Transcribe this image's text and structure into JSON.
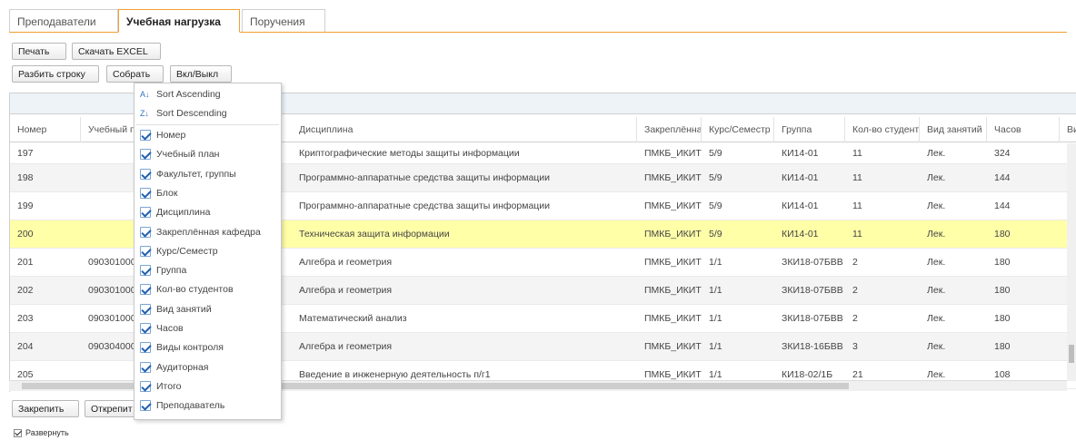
{
  "tabs": [
    {
      "label": "Преподаватели"
    },
    {
      "label": "Учебная нагрузка"
    },
    {
      "label": "Поручения"
    }
  ],
  "toolbar": {
    "print": "Печать",
    "excel": "Скачать EXCEL",
    "split": "Разбить строку",
    "collect": "Собрать",
    "toggle": "Вкл/Выкл",
    "pin": "Закрепить",
    "unpin": "Открепит"
  },
  "columns": {
    "nomer": "Номер",
    "plan": "Учебный п",
    "disc": "Дисциплина",
    "kaf": "Закреплённая",
    "kurs": "Курс/Семестр",
    "group": "Группа",
    "students": "Кол-во студент",
    "vid": "Вид занятий",
    "hours": "Часов",
    "vi": "Ви"
  },
  "rows": [
    {
      "nomer": "197",
      "plan": "",
      "disc": "Криптографические методы защиты информации",
      "kaf": "ПМКБ_ИКИТ",
      "kurs": "5/9",
      "group": "КИ14-01",
      "students": "11",
      "vid": "Лек.",
      "hours": "324",
      "vi": ":"
    },
    {
      "nomer": "198",
      "plan": "",
      "disc": "Программно-аппаратные средства защиты информации",
      "kaf": "ПМКБ_ИКИТ",
      "kurs": "5/9",
      "group": "КИ14-01",
      "students": "11",
      "vid": "Лек.",
      "hours": "144",
      "vi": ":"
    },
    {
      "nomer": "199",
      "plan": "",
      "disc": "Программно-аппаратные средства защиты информации",
      "kaf": "ПМКБ_ИКИТ",
      "kurs": "5/9",
      "group": "КИ14-01",
      "students": "11",
      "vid": "Лек.",
      "hours": "144",
      "vi": ":"
    },
    {
      "nomer": "200",
      "plan": "",
      "disc": "Техническая защита информации",
      "kaf": "ПМКБ_ИКИТ",
      "kurs": "5/9",
      "group": "КИ14-01",
      "students": "11",
      "vid": "Лек.",
      "hours": "180",
      "vi": ":"
    },
    {
      "nomer": "201",
      "plan": "090301000",
      "disc": "Алгебра и геометрия",
      "kaf": "ПМКБ_ИКИТ",
      "kurs": "1/1",
      "group": "ЗКИ18-07БВВ",
      "students": "2",
      "vid": "Лек.",
      "hours": "180",
      "vi": ":"
    },
    {
      "nomer": "202",
      "plan": "090301000",
      "disc": "Алгебра и геометрия",
      "kaf": "ПМКБ_ИКИТ",
      "kurs": "1/1",
      "group": "ЗКИ18-07БВВ",
      "students": "2",
      "vid": "Лек.",
      "hours": "180",
      "vi": ":"
    },
    {
      "nomer": "203",
      "plan": "090301000",
      "disc": "Математический анализ",
      "kaf": "ПМКБ_ИКИТ",
      "kurs": "1/1",
      "group": "ЗКИ18-07БВВ",
      "students": "2",
      "vid": "Лек.",
      "hours": "180",
      "vi": ":"
    },
    {
      "nomer": "204",
      "plan": "090304000",
      "disc": "Алгебра и геометрия",
      "kaf": "ПМКБ_ИКИТ",
      "kurs": "1/1",
      "group": "ЗКИ18-16БВВ",
      "students": "3",
      "vid": "Лек.",
      "hours": "180",
      "vi": ":"
    },
    {
      "nomer": "205",
      "plan": "",
      "disc": "Введение в инженерную деятельность п/г1",
      "kaf": "ПМКБ_ИКИТ",
      "kurs": "1/1",
      "group": "КИ18-02/1Б",
      "students": "21",
      "vid": "Лек.",
      "hours": "108",
      "vi": ":"
    }
  ],
  "menu": {
    "sort_asc": "Sort Ascending",
    "sort_desc": "Sort Descending",
    "columns": [
      {
        "label": "Номер",
        "checked": true
      },
      {
        "label": "Учебный план",
        "checked": true
      },
      {
        "label": "Факультет, группы",
        "checked": true
      },
      {
        "label": "Блок",
        "checked": true
      },
      {
        "label": "Дисциплина",
        "checked": true
      },
      {
        "label": "Закреплённая кафедра",
        "checked": true
      },
      {
        "label": "Курс/Семестр",
        "checked": true
      },
      {
        "label": "Группа",
        "checked": true
      },
      {
        "label": "Кол-во студентов",
        "checked": true
      },
      {
        "label": "Вид занятий",
        "checked": true
      },
      {
        "label": "Часов",
        "checked": true
      },
      {
        "label": "Виды контроля",
        "checked": true
      },
      {
        "label": "Аудиторная",
        "checked": true
      },
      {
        "label": "Итого",
        "checked": true
      },
      {
        "label": "Преподаватель",
        "checked": true
      }
    ]
  },
  "expand": {
    "label": "Развернуть",
    "checked": true
  },
  "colors": {
    "accent": "#f0a030",
    "selected_row": "#ffffa8",
    "check": "#2060b0"
  }
}
